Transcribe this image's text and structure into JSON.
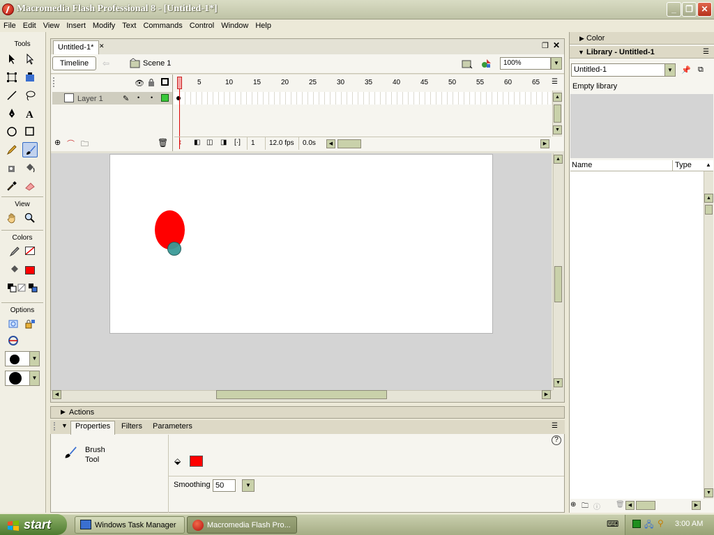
{
  "window": {
    "title": "Macromedia Flash Professional 8 - [Untitled-1*]"
  },
  "menu": [
    "File",
    "Edit",
    "View",
    "Insert",
    "Modify",
    "Text",
    "Commands",
    "Control",
    "Window",
    "Help"
  ],
  "tools": {
    "section_tools": "Tools",
    "section_view": "View",
    "section_colors": "Colors",
    "section_options": "Options",
    "stroke_color": "#000000",
    "fill_color": "#ff0000"
  },
  "document": {
    "tab_label": "Untitled-1*",
    "timeline_button": "Timeline",
    "scene_label": "Scene 1",
    "zoom": "100%"
  },
  "timeline": {
    "layer_name": "Layer 1",
    "ruler": [
      "1",
      "5",
      "10",
      "15",
      "20",
      "25",
      "30",
      "35",
      "40",
      "45",
      "50",
      "55",
      "60",
      "65"
    ],
    "current_frame": "1",
    "fps": "12.0 fps",
    "time": "0.0s"
  },
  "stage": {
    "background": "#ffffff",
    "shape_fill": "#ff0000",
    "dot_fill": "#3a9a98"
  },
  "panels": {
    "actions": "Actions",
    "tabs": [
      "Properties",
      "Filters",
      "Parameters"
    ],
    "tool_name_line1": "Brush",
    "tool_name_line2": "Tool",
    "smoothing_label": "Smoothing",
    "smoothing_value": "50",
    "help": "?"
  },
  "right": {
    "color_header": "Color",
    "library_header": "Library - Untitled-1",
    "library_select": "Untitled-1",
    "empty_text": "Empty library",
    "col_name": "Name",
    "col_type": "Type"
  },
  "taskbar": {
    "start": "start",
    "tasks": [
      "Windows Task Manager",
      "Macromedia Flash Pro..."
    ],
    "clock": "3:00 AM"
  }
}
